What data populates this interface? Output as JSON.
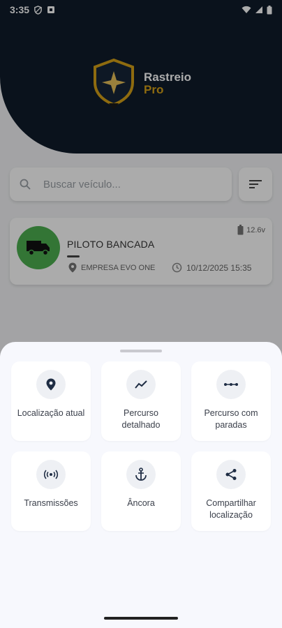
{
  "status_bar": {
    "time": "3:35"
  },
  "header": {
    "brand_line1": "Rastreio",
    "brand_line2": "Pro"
  },
  "search": {
    "placeholder": "Buscar veículo..."
  },
  "vehicle": {
    "name": "PILOTO BANCADA",
    "battery": "12.6v",
    "company": "EMPRESA EVO ONE",
    "timestamp": "10/12/2025 15:35",
    "avatar_color": "#4caf50"
  },
  "sheet": {
    "actions": [
      {
        "label": "Localização atual",
        "icon": "location-pin-icon"
      },
      {
        "label": "Percurso detalhado",
        "icon": "trending-line-icon"
      },
      {
        "label": "Percurso com paradas",
        "icon": "route-stops-icon"
      },
      {
        "label": "Transmissões",
        "icon": "broadcast-icon"
      },
      {
        "label": "Âncora",
        "icon": "anchor-icon"
      },
      {
        "label": "Compartilhar localização",
        "icon": "share-icon"
      }
    ]
  },
  "colors": {
    "header_bg": "#0f1b2a",
    "brand_gold": "#d4a017",
    "sheet_bg": "#f7f8fd"
  }
}
